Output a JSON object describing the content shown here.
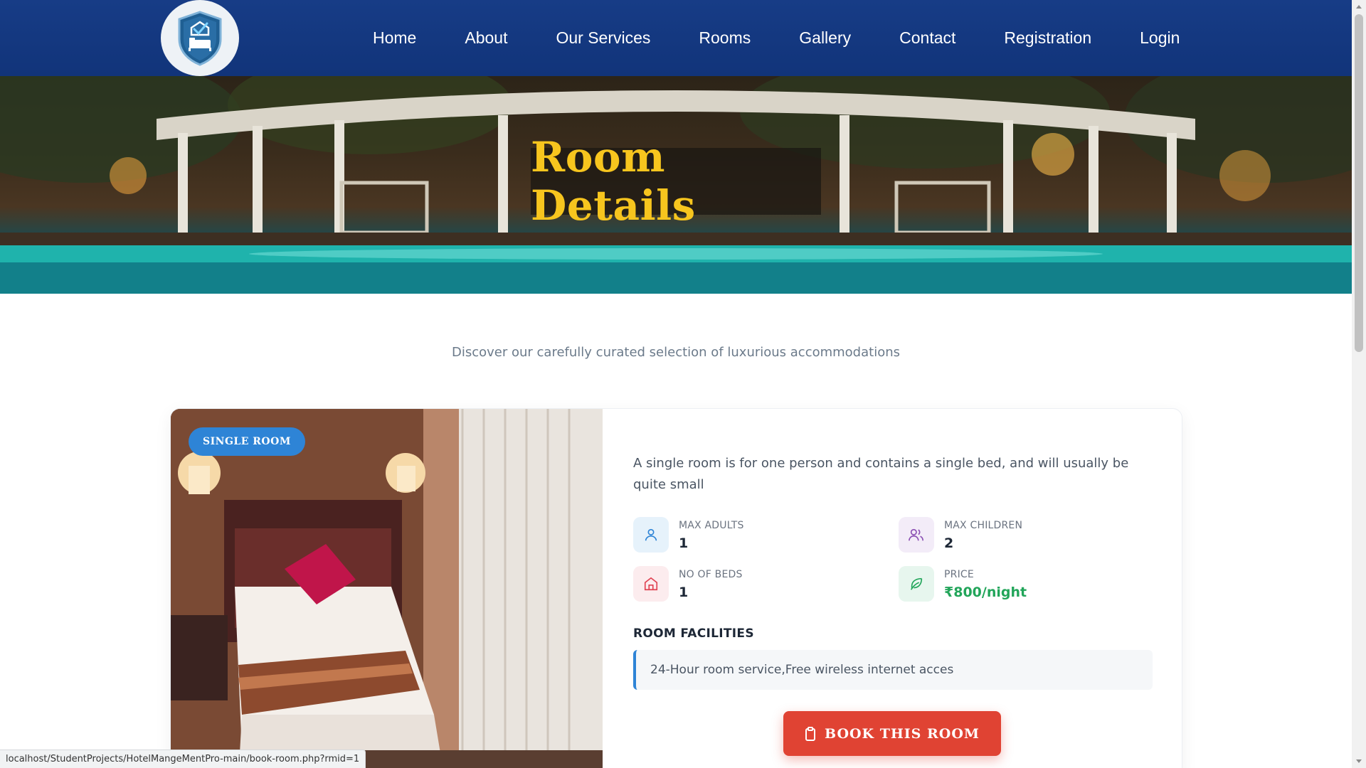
{
  "nav": {
    "logo_alt": "hotel-logo",
    "links": [
      {
        "label": "Home"
      },
      {
        "label": "About"
      },
      {
        "label": "Our Services"
      },
      {
        "label": "Rooms"
      },
      {
        "label": "Gallery"
      },
      {
        "label": "Contact"
      },
      {
        "label": "Registration"
      },
      {
        "label": "Login"
      }
    ]
  },
  "hero": {
    "title": "Room Details"
  },
  "subtitle": "Discover our carefully curated selection of luxurious accommodations",
  "room": {
    "badge": "SINGLE ROOM",
    "description": "A single room is for one person and contains a single bed, and will usually be quite small",
    "stats": {
      "max_adults": {
        "label": "MAX ADULTS",
        "value": "1"
      },
      "max_children": {
        "label": "MAX CHILDREN",
        "value": "2"
      },
      "beds": {
        "label": "NO OF BEDS",
        "value": "1"
      },
      "price": {
        "label": "PRICE",
        "value": "₹800/night"
      }
    },
    "facilities_title": "ROOM FACILITIES",
    "facilities": "24-Hour room service,Free wireless internet acces",
    "book_label": "BOOK THIS ROOM"
  },
  "status_bar": {
    "url": "localhost/StudentProjects/HotelMangeMentPro-main/book-room.php?rmid=1"
  },
  "colors": {
    "nav_bg": "#133880",
    "hero_title": "#f7c51e",
    "badge": "#2e84d6",
    "book_button": "#e04333",
    "price": "#22a55a"
  }
}
